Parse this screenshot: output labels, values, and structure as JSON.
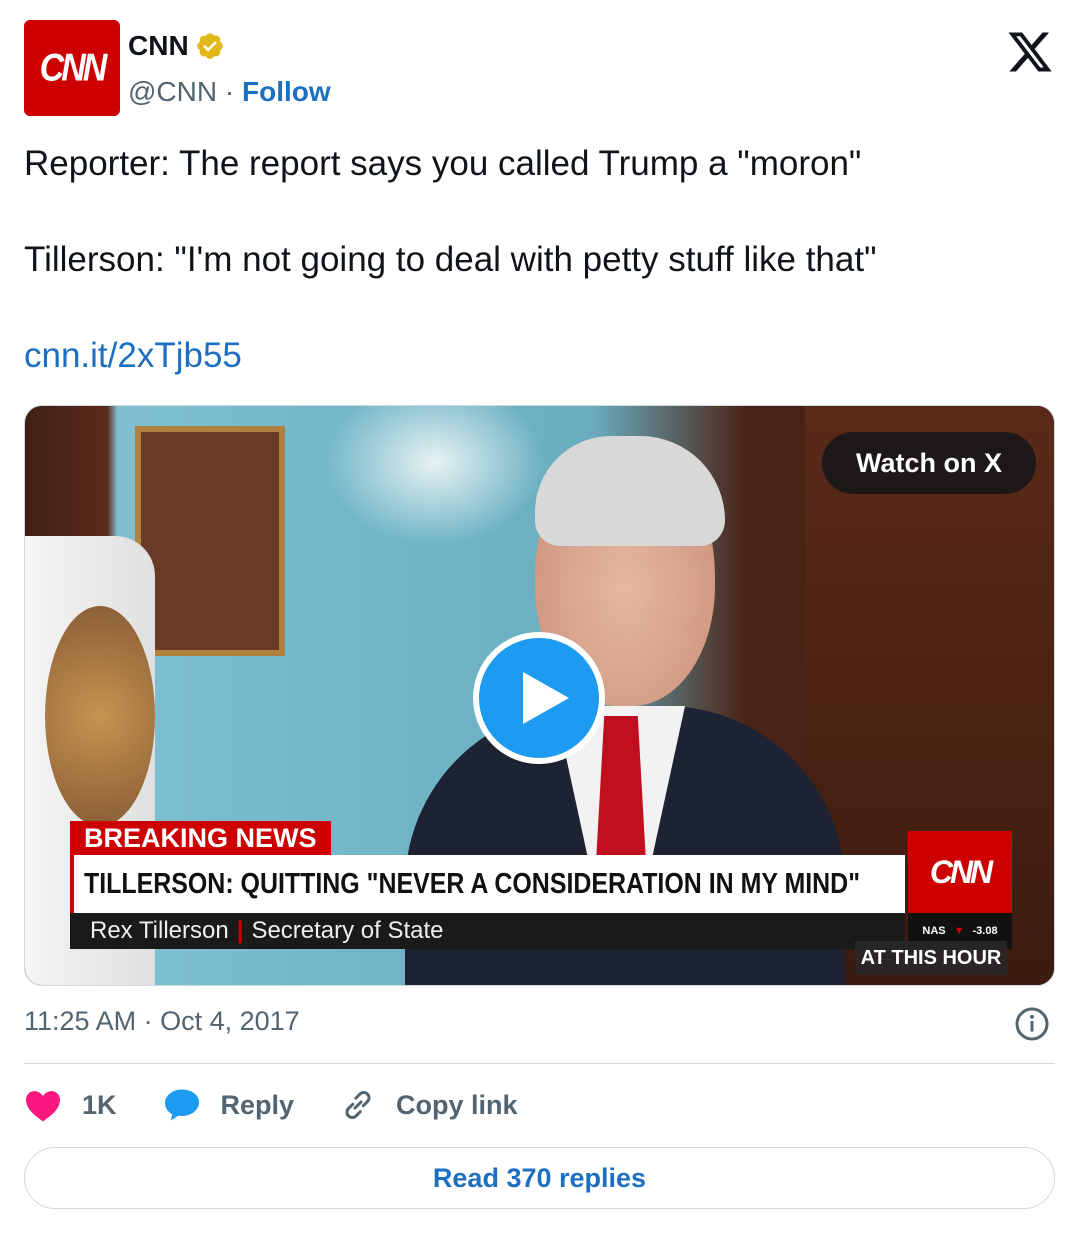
{
  "author": {
    "avatar_text": "CNN",
    "name": "CNN",
    "handle": "@CNN",
    "separator": " · ",
    "follow_label": "Follow"
  },
  "tweet": {
    "line1": "Reporter: The report says you called Trump a \"moron\"",
    "line2": "Tillerson: \"I'm not going to deal with petty stuff like that\"",
    "link": "cnn.it/2xTjb55"
  },
  "video": {
    "watch_label": "Watch on X",
    "breaking": "BREAKING NEWS",
    "headline": "TILLERSON: QUITTING \"NEVER A CONSIDERATION IN MY MIND\"",
    "speaker_name": "Rex Tillerson",
    "speaker_title": "Secretary of State",
    "bug_text": "CNN",
    "ticker_symbol": "NAS",
    "ticker_value": "-3.08",
    "program": "AT THIS HOUR"
  },
  "meta": {
    "timestamp": "11:25 AM · Oct 4, 2017"
  },
  "actions": {
    "like_count": "1K",
    "reply_label": "Reply",
    "copy_label": "Copy link"
  },
  "read_replies_label": "Read 370 replies",
  "colors": {
    "link": "#1d6fc2",
    "like": "#f91880",
    "reply": "#1d9bf0",
    "cnn_red": "#cc0000"
  }
}
